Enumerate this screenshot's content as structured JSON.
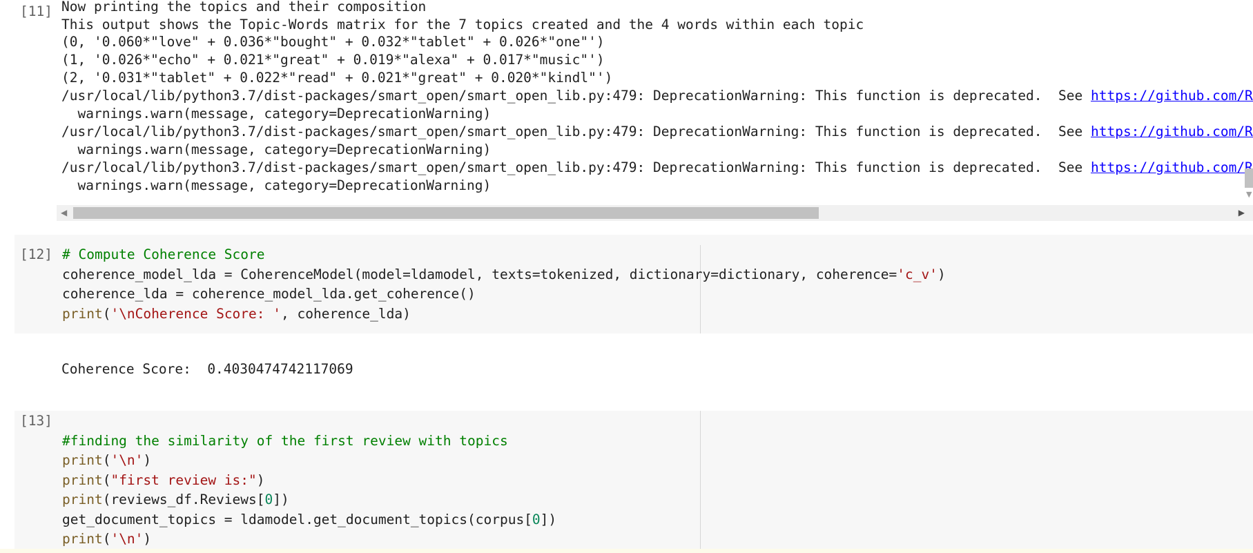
{
  "cells": {
    "c11": {
      "prompt": "[11]",
      "output": [
        "Now printing the topics and their composition",
        "This output shows the Topic-Words matrix for the 7 topics created and the 4 words within each topic",
        "(0, '0.060*\"love\" + 0.036*\"bought\" + 0.032*\"tablet\" + 0.026*\"one\"')",
        "(1, '0.026*\"echo\" + 0.021*\"great\" + 0.019*\"alexa\" + 0.017*\"music\"')",
        "(2, '0.031*\"tablet\" + 0.022*\"read\" + 0.021*\"great\" + 0.020*\"kindl\"')"
      ],
      "warning_prefix": "/usr/local/lib/python3.7/dist-packages/smart_open/smart_open_lib.py:479: DeprecationWarning: This function is deprecated.  See ",
      "warning_link": "https://github.com/Ral",
      "warning_detail": "  warnings.warn(message, category=DeprecationWarning)"
    },
    "c12": {
      "prompt": "[12]",
      "comment": "# Compute Coherence Score",
      "l2": "coherence_model_lda = CoherenceModel(model=ldamodel, texts=tokenized, dictionary=dictionary, coherence=",
      "l2_str": "'c_v'",
      "l2_end": ")",
      "l3": "coherence_lda = coherence_model_lda.get_coherence()",
      "l4_fn": "print",
      "l4_open": "(",
      "l4_str": "'\\nCoherence Score: '",
      "l4_rest": ", coherence_lda)",
      "output": "Coherence Score:  0.4030474742117069"
    },
    "c13": {
      "prompt": "[13]",
      "comment": "#finding the similarity of the first review with topics",
      "p1_fn": "print",
      "p1_str": "'\\n'",
      "p2_fn": "print",
      "p2_str": "\"first review is:\"",
      "p3_fn": "print",
      "p3_a": "(reviews_df.Reviews[",
      "p3_num": "0",
      "p3_b": "])",
      "l4a": "get_document_topics = ldamodel.get_document_topics(corpus[",
      "l4_num": "0",
      "l4b": "])",
      "p5_fn": "print",
      "p5_str": "'\\n'"
    }
  },
  "scroll": {
    "left_arrow": "◀",
    "right_arrow": "▶",
    "down_arrow": "▼"
  }
}
